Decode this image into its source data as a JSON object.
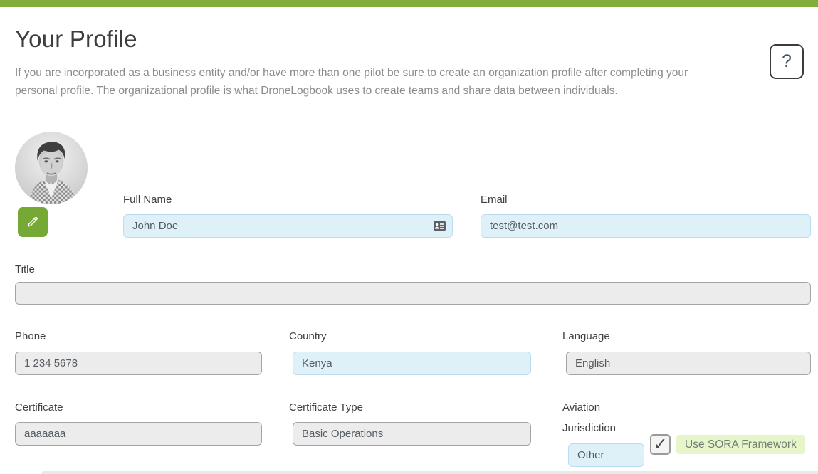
{
  "page": {
    "title": "Your Profile",
    "description": "If you are incorporated as a business entity and/or have more than one pilot be sure to create an organization profile after completing your personal profile. The organizational profile is what DroneLogbook uses to create teams and share data between individuals.",
    "help_label": "?"
  },
  "icons": {
    "checkmark": "✓"
  },
  "colors": {
    "top_bar_green": "#81ae3a",
    "edit_button_green": "#75a834",
    "input_blue_bg": "#def0f8",
    "input_blue_border": "#bcdded",
    "input_gray_bg": "#ececec",
    "input_gray_border": "#a5a5a5",
    "sora_chip_bg": "#e6f6ca"
  },
  "form": {
    "full_name": {
      "label": "Full Name",
      "value": "John Doe"
    },
    "email": {
      "label": "Email",
      "value": "test@test.com"
    },
    "title": {
      "label": "Title",
      "value": ""
    },
    "phone": {
      "label": "Phone",
      "value": "1 234 5678"
    },
    "country": {
      "label": "Country",
      "value": "Kenya"
    },
    "language": {
      "label": "Language",
      "value": "English"
    },
    "certificate": {
      "label": "Certificate",
      "value": "aaaaaaa"
    },
    "certificate_type": {
      "label": "Certificate Type",
      "value": "Basic Operations"
    },
    "aviation_jurisdiction": {
      "label": "Aviation Jurisdiction",
      "value": "Other"
    },
    "sora": {
      "label": "Use SORA Framework",
      "checked": true
    }
  }
}
